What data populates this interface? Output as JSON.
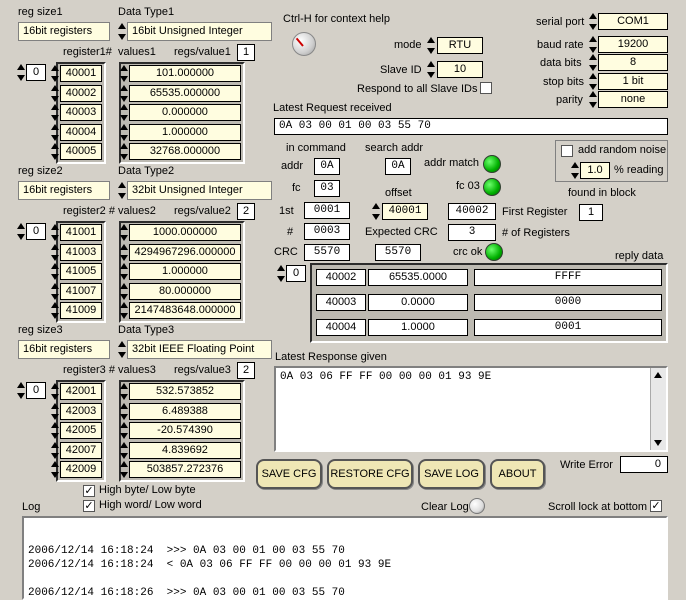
{
  "help_text": "Ctrl-H for context help",
  "groups": [
    {
      "reg_size_label": "reg size1",
      "reg_size_value": "16bit registers",
      "data_type_label": "Data Type1",
      "data_type_value": "16bit Unsigned Integer",
      "reg_header": "register1#",
      "values_header": "values1",
      "regs_per_value_label": "regs/value1",
      "regs_per_value": "1",
      "index": "0",
      "registers": [
        "40001",
        "40002",
        "40003",
        "40004",
        "40005"
      ],
      "values": [
        "101.000000",
        "65535.000000",
        "0.000000",
        "1.000000",
        "32768.000000"
      ]
    },
    {
      "reg_size_label": "reg size2",
      "reg_size_value": "16bit registers",
      "data_type_label": "Data Type2",
      "data_type_value": "32bit Unsigned Integer",
      "reg_header": "register2 #",
      "values_header": "values2",
      "regs_per_value_label": "regs/value2",
      "regs_per_value": "2",
      "index": "0",
      "registers": [
        "41001",
        "41003",
        "41005",
        "41007",
        "41009"
      ],
      "values": [
        "1000.000000",
        "4294967296.000000",
        "1.000000",
        "80.000000",
        "2147483648.000000"
      ]
    },
    {
      "reg_size_label": "reg size3",
      "reg_size_value": "16bit registers",
      "data_type_label": "Data Type3",
      "data_type_value": "32bit IEEE Floating Point",
      "reg_header": "register3 #",
      "values_header": "values3",
      "regs_per_value_label": "regs/value3",
      "regs_per_value": "2",
      "index": "0",
      "registers": [
        "42001",
        "42003",
        "42005",
        "42007",
        "42009"
      ],
      "values": [
        "532.573852",
        "6.489388",
        "-20.574390",
        "4.839692",
        "503857.272376"
      ]
    }
  ],
  "mode": {
    "label": "mode",
    "value": "RTU"
  },
  "slave_id": {
    "label": "Slave ID",
    "value": "10"
  },
  "respond_all": {
    "label": "Respond to all Slave IDs"
  },
  "serial": {
    "port_label": "serial port",
    "port": "COM1",
    "baud_label": "baud rate",
    "baud": "19200",
    "databits_label": "data bits",
    "databits": "8",
    "stopbits_label": "stop bits",
    "stopbits": "1 bit",
    "parity_label": "parity",
    "parity": "none"
  },
  "latest_request": {
    "label": "Latest Request received",
    "value": "0A 03 00 01 00 03 55 70"
  },
  "command": {
    "header": "in command",
    "addr_label": "addr",
    "addr": "0A",
    "fc_label": "fc",
    "fc": "03",
    "first_label": "1st",
    "first": "0001",
    "count_label": "#",
    "count": "0003",
    "crc_label": "CRC",
    "crc": "5570"
  },
  "search": {
    "header": "search addr",
    "addr": "0A",
    "addr_match_label": "addr match",
    "fc03_label": "fc 03",
    "offset_label": "offset",
    "offset": "40001",
    "expected_crc_label": "Expected CRC",
    "expected_crc": "5570",
    "crc_ok_label": "crc ok"
  },
  "first_register": {
    "value": "40002",
    "label": "First Register"
  },
  "num_registers": {
    "value": "3",
    "label": "# of Registers"
  },
  "noise": {
    "checkbox_label": "add random noise",
    "value": "1.0",
    "unit_label": "% reading"
  },
  "found_in_block": {
    "label": "found in block",
    "value": "1"
  },
  "reply": {
    "label": "reply data",
    "index": "0",
    "rows": [
      {
        "register": "40002",
        "value": "65535.0000",
        "hex": "FFFF"
      },
      {
        "register": "40003",
        "value": "0.0000",
        "hex": "0000"
      },
      {
        "register": "40004",
        "value": "1.0000",
        "hex": "0001"
      }
    ]
  },
  "latest_response": {
    "label": "Latest Response given",
    "value": "0A 03 06 FF FF 00 00 00 01 93 9E"
  },
  "buttons": {
    "save_cfg": "SAVE CFG",
    "restore_cfg": "RESTORE CFG",
    "save_log": "SAVE LOG",
    "about": "ABOUT"
  },
  "write_error": {
    "label": "Write Error",
    "value": "0"
  },
  "byte_order": {
    "high_byte_label": "High byte/ Low byte",
    "high_word_label": "High word/ Low word"
  },
  "log": {
    "label": "Log",
    "clear_label": "Clear Log",
    "scroll_lock_label": "Scroll lock at bottom",
    "lines": [
      "",
      "2006/12/14 16:18:24  >>> 0A 03 00 01 00 03 55 70",
      "2006/12/14 16:18:24  < 0A 03 06 FF FF 00 00 00 01 93 9E",
      "",
      "2006/12/14 16:18:26  >>> 0A 03 00 01 00 03 55 70"
    ]
  }
}
